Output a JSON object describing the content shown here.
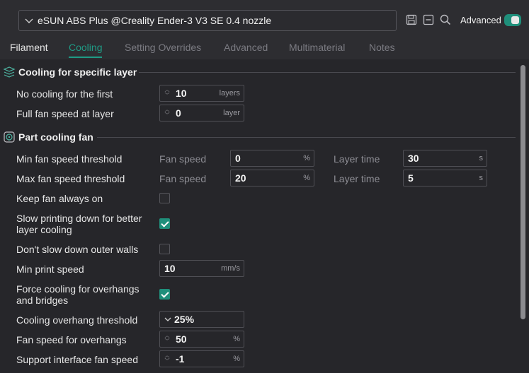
{
  "header": {
    "preset": "eSUN ABS Plus @Creality Ender-3 V3 SE 0.4 nozzle",
    "advanced_label": "Advanced",
    "advanced_on": true
  },
  "tabs": [
    "Filament",
    "Cooling",
    "Setting Overrides",
    "Advanced",
    "Multimaterial",
    "Notes"
  ],
  "active_tab": "Cooling",
  "sections": {
    "specific_layer": {
      "title": "Cooling for specific layer",
      "no_cooling_label": "No cooling for the first",
      "no_cooling_value": "10",
      "no_cooling_unit": "layers",
      "full_fan_label": "Full fan speed at layer",
      "full_fan_value": "0",
      "full_fan_unit": "layer"
    },
    "part_fan": {
      "title": "Part cooling fan",
      "min_fan_label": "Min fan speed threshold",
      "max_fan_label": "Max fan speed threshold",
      "fan_speed_label": "Fan speed",
      "layer_time_label": "Layer time",
      "min_fan_speed": "0",
      "min_layer_time": "30",
      "max_fan_speed": "20",
      "max_layer_time": "5",
      "percent_unit": "%",
      "seconds_unit": "s",
      "keep_fan_label": "Keep fan always on",
      "keep_fan_checked": false,
      "slow_down_label_1": "Slow printing down for better",
      "slow_down_label_2": "layer cooling",
      "slow_down_checked": true,
      "dont_slow_label": "Don't slow down outer walls",
      "dont_slow_checked": false,
      "min_print_label": "Min print speed",
      "min_print_value": "10",
      "min_print_unit": "mm/s",
      "force_cool_label_1": "Force cooling for overhangs",
      "force_cool_label_2": "and bridges",
      "force_cool_checked": true,
      "overhang_thresh_label": "Cooling overhang threshold",
      "overhang_thresh_value": "25%",
      "overhang_fan_label": "Fan speed for overhangs",
      "overhang_fan_value": "50",
      "support_fan_label": "Support interface fan speed",
      "support_fan_value": "-1"
    }
  },
  "colors": {
    "accent": "#1f9b85",
    "background": "#26262a"
  }
}
